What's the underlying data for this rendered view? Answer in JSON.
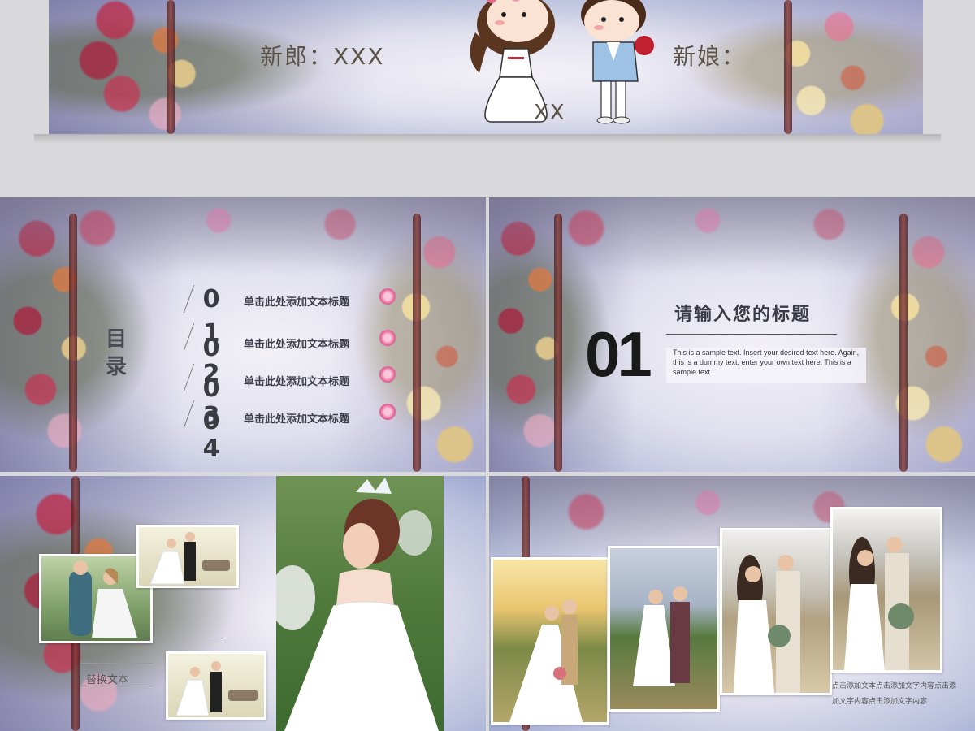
{
  "hero": {
    "groom_label": "新郎：XXX",
    "bride_label": "新娘：",
    "caption": "XX"
  },
  "toc": {
    "title_line1": "目",
    "title_line2": "录",
    "numbers": [
      "0",
      "1",
      "0",
      "2",
      "0",
      "3",
      "0",
      "4"
    ],
    "items": [
      "单击此处添加文本标题",
      "单击此处添加文本标题",
      "单击此处添加文本标题",
      "单击此处添加文本标题"
    ]
  },
  "section": {
    "number": "01",
    "title": "请输入您的标题",
    "body": "This is a sample text. Insert your desired text here. Again, this is a dummy text, enter your own text here. This is a sample text"
  },
  "photosA": {
    "caption": "替换文本"
  },
  "photosB": {
    "body": "点击添加文本点击添加文字内容点击添加文字内容点击添加文字内容"
  },
  "colors": {
    "background": "#d9d9db",
    "title_text": "#3a3a44",
    "accent_rose": "#e6689b"
  }
}
